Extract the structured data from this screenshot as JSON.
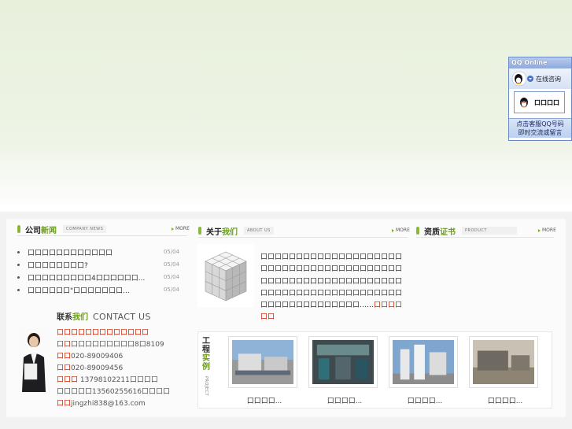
{
  "news": {
    "title_a": "公司",
    "title_b": "新闻",
    "subtitle": "COMPANY NEWS",
    "more": "MORE",
    "items": [
      {
        "title": "口口口口口口口口口口口口",
        "date": "05/04"
      },
      {
        "title": "口口口口口口口口?",
        "date": "05/04"
      },
      {
        "title": "口口口口口口口口口4口口口口口口...",
        "date": "05/04"
      },
      {
        "title": "口口口口口口\"口口口口口口口...",
        "date": "05/04"
      }
    ]
  },
  "contact": {
    "title_a": "联系",
    "title_b": "我们",
    "title_en": "CONTACT US",
    "company": "口口口口口口口口口口口口口",
    "lines": [
      {
        "label": "口口",
        "value": "口口口口口口口口口8口8109"
      },
      {
        "label": "口口",
        "value": "020-89009406"
      },
      {
        "label": "口口",
        "value": "020-89009456"
      },
      {
        "label": "口口口",
        "value": " 13798102211口口口口"
      },
      {
        "label": "",
        "value": "口口口口口13560255616口口口口"
      },
      {
        "label": "口口",
        "value": "jingzhi838@163.com"
      }
    ]
  },
  "about": {
    "title_a": "关于",
    "title_b": "我们",
    "subtitle": "ABOUT US",
    "more": "MORE",
    "text": "口口口口口口口口口口口口口口口口口口口口口口口口口口口口口口口口口口口口口口口口口口口口口口口口口口口口口口口口口口口口口口口口口口口口口口口口口口口口口口口口口口口口口口口口口口口口口口……",
    "detail": "口口口口口口"
  },
  "cert": {
    "title_a": "资质",
    "title_b": "证书",
    "subtitle": "PRODUCT",
    "more": "MORE"
  },
  "projects": {
    "label_chars": [
      "工",
      "程",
      "实",
      "例"
    ],
    "subtitle": "PROJECT",
    "items": [
      {
        "caption": "口口口口..."
      },
      {
        "caption": "口口口口..."
      },
      {
        "caption": "口口口口..."
      },
      {
        "caption": "口口口口..."
      }
    ]
  },
  "qq": {
    "header": "QQ Online",
    "consult": "在线咨询",
    "service": "口口口口",
    "footer_line1": "点击客服QQ号码",
    "footer_line2": "即时交流或留言"
  },
  "colors": {
    "accent_green": "#6a9e1a",
    "link_red": "#cc2200",
    "qq_blue": "#8fa9dd"
  }
}
